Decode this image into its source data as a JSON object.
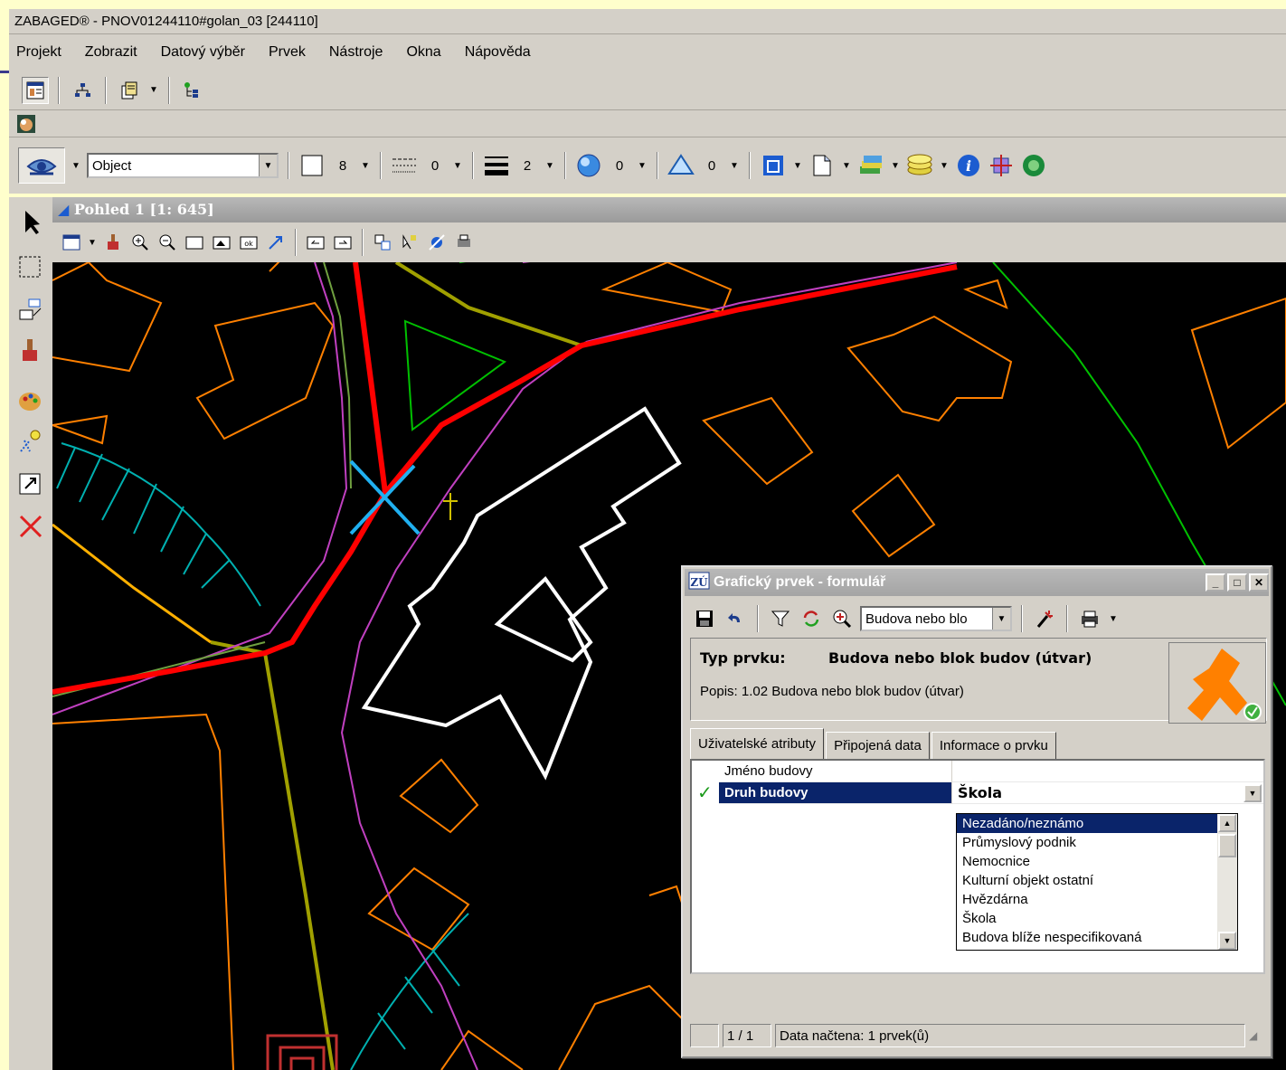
{
  "window": {
    "title": "ZABAGED® - PNOV01244110#golan_03 [244110]"
  },
  "menu": [
    "Projekt",
    "Zobrazit",
    "Datový výběr",
    "Prvek",
    "Nástroje",
    "Okna",
    "Nápověda"
  ],
  "style_toolbar": {
    "object_combo": "Object",
    "color_value": "8",
    "line_style_value": "0",
    "line_weight_value": "2",
    "transparency_value": "0",
    "priority_value": "0"
  },
  "view": {
    "title": "Pohled 1 [1: 645]"
  },
  "dialog": {
    "title": "Grafický prvek - formulář",
    "feature_combo": "Budova nebo blo",
    "type_label": "Typ prvku:",
    "type_value": "Budova nebo blok budov (útvar)",
    "description": "Popis:  1.02 Budova nebo blok budov (útvar)",
    "tabs": [
      "Uživatelské atributy",
      "Připojená data",
      "Informace o prvku"
    ],
    "attributes": [
      {
        "name": "Jméno budovy",
        "value": ""
      },
      {
        "name": "Druh budovy",
        "value": "Škola"
      }
    ],
    "dropdown_options": [
      "Nezadáno/neznámo",
      "Průmyslový podnik",
      "Nemocnice",
      "Kulturní objekt ostatní",
      "Hvězdárna",
      "Škola",
      "Budova blíže nespecifikovaná"
    ],
    "highlighted_option": "Nezadáno/neznámo",
    "status_count": "1 / 1",
    "status_text": "Data načtena: 1 prvek(ů)"
  },
  "colors": {
    "map_background": "#000000",
    "road_red": "#ff0000",
    "building_orange": "#ff8000",
    "selected_building": "#ffffff",
    "border_magenta": "#c040c0",
    "railway_green": "#00c000",
    "road_olive": "#a0a000",
    "slope_cyan": "#00b0b0",
    "highlight_navy": "#0a246a"
  }
}
